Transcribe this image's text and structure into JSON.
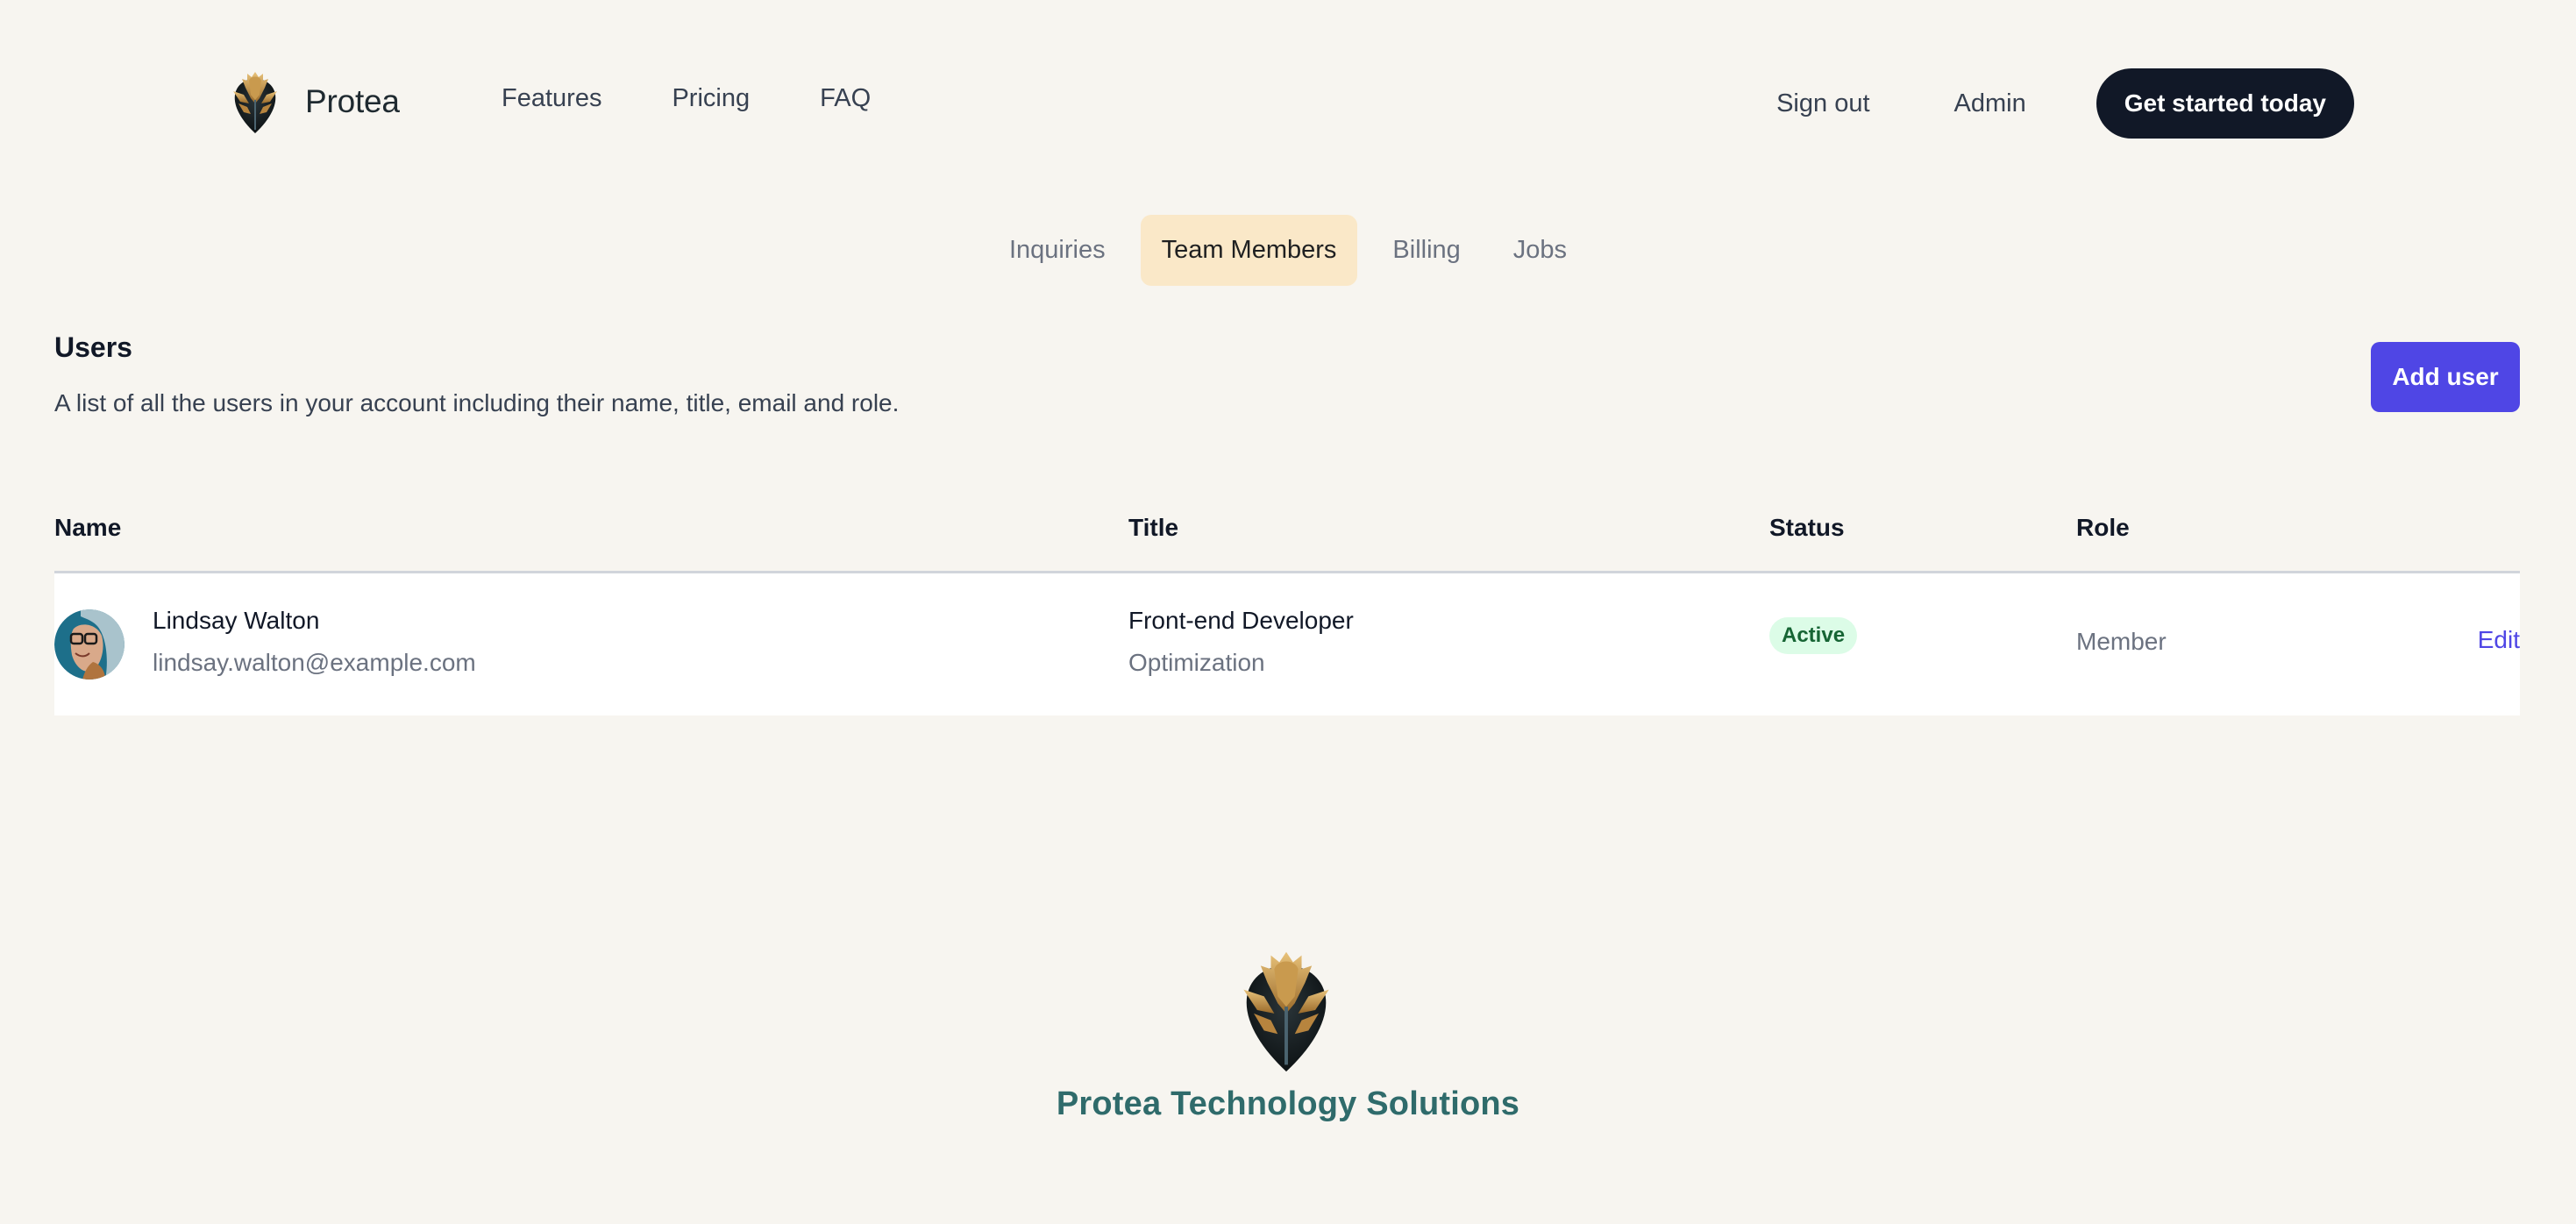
{
  "header": {
    "brand_name": "Protea",
    "brand_logo_icon": "protea-flower-logo-icon",
    "nav_left": [
      {
        "label": "Features"
      },
      {
        "label": "Pricing"
      },
      {
        "label": "FAQ"
      }
    ],
    "nav_right": [
      {
        "label": "Sign out"
      },
      {
        "label": "Admin"
      }
    ],
    "cta_label": "Get started today"
  },
  "tabs": [
    {
      "label": "Inquiries",
      "active": false
    },
    {
      "label": "Team Members",
      "active": true
    },
    {
      "label": "Billing",
      "active": false
    },
    {
      "label": "Jobs",
      "active": false
    }
  ],
  "users": {
    "title": "Users",
    "description": "A list of all the users in your account including their name, title, email and role.",
    "add_user_label": "Add user",
    "columns": [
      "Name",
      "Title",
      "Status",
      "Role"
    ],
    "rows": [
      {
        "name": "Lindsay Walton",
        "email": "lindsay.walton@example.com",
        "title": "Front-end Developer",
        "department": "Optimization",
        "status": "Active",
        "role": "Member",
        "action_label": "Edit"
      }
    ]
  },
  "footer": {
    "company_name": "Protea Technology Solutions",
    "logo_icon": "protea-flower-logo-icon"
  },
  "colors": {
    "background": "#f7f5f0",
    "primary_dark": "#111827",
    "accent": "#4f46e5",
    "active_tab": "#fae8c8",
    "status_active_bg": "#dcfce7",
    "status_active_text": "#166534",
    "footer_text": "#2f6b6b"
  }
}
